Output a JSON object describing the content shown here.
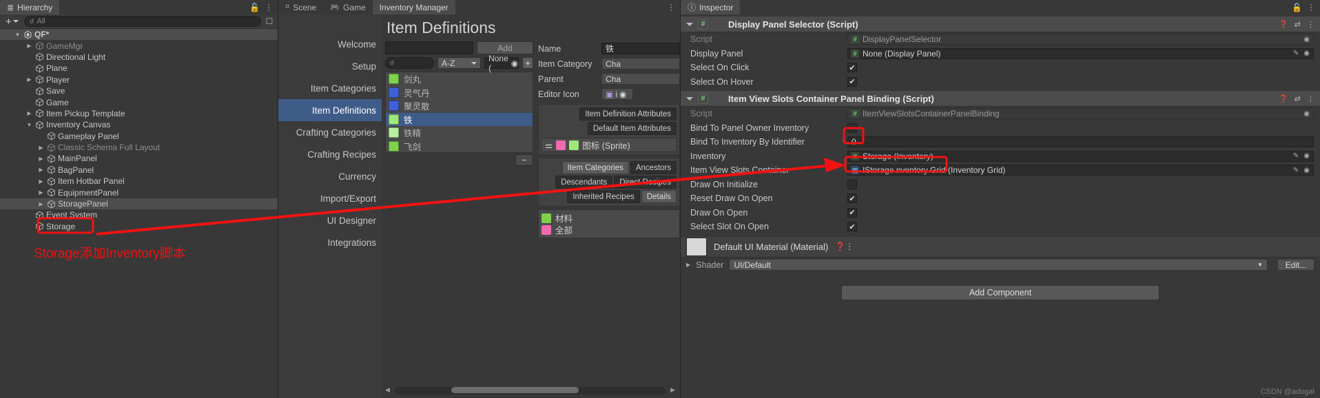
{
  "hierarchy": {
    "tab_label": "Hierarchy",
    "toolbar": {
      "add_label": "+",
      "search_placeholder": "All",
      "search_value": ""
    },
    "items": [
      {
        "label": "QF*",
        "depth": 0,
        "arrow": "open",
        "icon": "unity-logo-icon",
        "selected": true,
        "dim": false
      },
      {
        "label": "GameMgr",
        "depth": 1,
        "arrow": "closed",
        "icon": "cube-icon",
        "selected": false,
        "dim": true
      },
      {
        "label": "Directional Light",
        "depth": 1,
        "arrow": "none",
        "icon": "cube-icon",
        "selected": false,
        "dim": false
      },
      {
        "label": "Plane",
        "depth": 1,
        "arrow": "none",
        "icon": "cube-icon",
        "selected": false,
        "dim": false
      },
      {
        "label": "Player",
        "depth": 1,
        "arrow": "closed",
        "icon": "cube-icon",
        "selected": false,
        "dim": false
      },
      {
        "label": "Save",
        "depth": 1,
        "arrow": "none",
        "icon": "cube-icon",
        "selected": false,
        "dim": false
      },
      {
        "label": "Game",
        "depth": 1,
        "arrow": "none",
        "icon": "cube-icon",
        "selected": false,
        "dim": false
      },
      {
        "label": "Item Pickup Template",
        "depth": 1,
        "arrow": "closed",
        "icon": "cube-icon",
        "selected": false,
        "dim": false
      },
      {
        "label": "Inventory Canvas",
        "depth": 1,
        "arrow": "open",
        "icon": "cube-icon",
        "selected": false,
        "dim": false
      },
      {
        "label": "Gameplay Panel",
        "depth": 2,
        "arrow": "none",
        "icon": "cube-icon",
        "selected": false,
        "dim": false
      },
      {
        "label": "Classic Schema Full Layout",
        "depth": 2,
        "arrow": "closed",
        "icon": "cube-icon",
        "selected": false,
        "dim": true
      },
      {
        "label": "MainPanel",
        "depth": 2,
        "arrow": "closed",
        "icon": "cube-icon",
        "selected": false,
        "dim": false
      },
      {
        "label": "BagPanel",
        "depth": 2,
        "arrow": "closed",
        "icon": "cube-icon",
        "selected": false,
        "dim": false
      },
      {
        "label": "Item Hotbar Panel",
        "depth": 2,
        "arrow": "closed",
        "icon": "cube-icon",
        "selected": false,
        "dim": false
      },
      {
        "label": "EquipmentPanel",
        "depth": 2,
        "arrow": "closed",
        "icon": "cube-icon",
        "selected": false,
        "dim": false
      },
      {
        "label": "StoragePanel",
        "depth": 2,
        "arrow": "closed",
        "icon": "cube-icon",
        "selected": true,
        "dim": false
      },
      {
        "label": "Event System",
        "depth": 1,
        "arrow": "none",
        "icon": "cube-icon",
        "selected": false,
        "dim": false
      },
      {
        "label": "Storage",
        "depth": 1,
        "arrow": "none",
        "icon": "cube-icon",
        "selected": false,
        "dim": false
      }
    ],
    "annotation": "Storage添加Inventory脚本"
  },
  "center": {
    "tabs": [
      {
        "label": "Scene",
        "icon": "grid-icon",
        "active": false
      },
      {
        "label": "Game",
        "icon": "gamepad-icon",
        "active": false
      },
      {
        "label": "Inventory Manager",
        "icon": "none",
        "active": true
      }
    ],
    "nav": [
      {
        "label": "Welcome",
        "active": false
      },
      {
        "label": "Setup",
        "active": false
      },
      {
        "label": "Item Categories",
        "active": false
      },
      {
        "label": "Item Definitions",
        "active": true
      },
      {
        "label": "Crafting Categories",
        "active": false
      },
      {
        "label": "Crafting Recipes",
        "active": false
      },
      {
        "label": "Currency",
        "active": false
      },
      {
        "label": "Import/Export",
        "active": false
      },
      {
        "label": "UI Designer",
        "active": false
      },
      {
        "label": "Integrations",
        "active": false
      }
    ],
    "page_title": "Item Definitions",
    "add_button": "Add",
    "new_name_value": "",
    "search_placeholder": "",
    "sort_value": "A-Z",
    "filter_value": "None (",
    "plus_button": "+",
    "minus_button": "−",
    "item_list": [
      {
        "label": "剑丸",
        "color": "#7ed14a",
        "selected": false
      },
      {
        "label": "灵气丹",
        "color": "#3f62d8",
        "selected": false
      },
      {
        "label": "聚灵散",
        "color": "#3f62d8",
        "selected": false
      },
      {
        "label": "铁",
        "color": "#9fe87c",
        "selected": true
      },
      {
        "label": "铁精",
        "color": "#b7f0a0",
        "selected": false
      },
      {
        "label": "飞剑",
        "color": "#7ed14a",
        "selected": false
      }
    ],
    "detail": {
      "name_label": "Name",
      "name_value": "铁",
      "category_label": "Item Category",
      "category_value": "Cha",
      "parent_label": "Parent",
      "parent_value": "Cha",
      "editor_icon_label": "Editor Icon",
      "editor_icon_value": "i",
      "tabs_row1": [
        "Item Definition Attributes"
      ],
      "tabs_row2": [
        "Default Item Attributes"
      ],
      "sprite_value": "图标 (Sprite)",
      "cat_tabs": [
        "Item Categories",
        "Ancestors",
        "Descendants",
        "Direct Recipes",
        "Inherited Recipes",
        "Details"
      ],
      "tags": [
        {
          "label": "材料",
          "color": "#7ed14a"
        },
        {
          "label": "全部",
          "color": "#f06ab0"
        }
      ]
    }
  },
  "inspector": {
    "tab_label": "Inspector",
    "components": [
      {
        "title": "Display Panel Selector (Script)",
        "properties": [
          {
            "label": "Script",
            "type": "object",
            "value": "DisplayPanelSelector",
            "disabled": true,
            "highlight": false
          },
          {
            "label": "Display Panel",
            "type": "object",
            "value": "None (Display Panel)",
            "disabled": false,
            "highlight": false
          },
          {
            "label": "Select On Click",
            "type": "checkbox",
            "value": "✔",
            "disabled": false,
            "highlight": false
          },
          {
            "label": "Select On Hover",
            "type": "checkbox",
            "value": "✔",
            "disabled": false,
            "highlight": false
          }
        ]
      },
      {
        "title": "Item View Slots Container Panel Binding (Script)",
        "properties": [
          {
            "label": "Script",
            "type": "object",
            "value": "ItemViewSlotsContainerPanelBinding",
            "disabled": true,
            "highlight": false
          },
          {
            "label": "Bind To Panel Owner Inventory",
            "type": "checkbox",
            "value": "",
            "disabled": false,
            "highlight": true
          },
          {
            "label": "Bind To Inventory By Identifier",
            "type": "number",
            "value": "0",
            "disabled": false,
            "highlight": false
          },
          {
            "label": "Inventory",
            "type": "object",
            "value": "Storage (Inventory)",
            "disabled": false,
            "highlight": true
          },
          {
            "label": "Item View Slots Container",
            "type": "object",
            "value": "IStorage nventory Grid (Inventory Grid)",
            "disabled": false,
            "highlight": false
          },
          {
            "label": "Draw On Initialize",
            "type": "checkbox",
            "value": "",
            "disabled": false,
            "highlight": false
          },
          {
            "label": "Reset Draw On Open",
            "type": "checkbox",
            "value": "✔",
            "disabled": false,
            "highlight": false
          },
          {
            "label": "Draw On Open",
            "type": "checkbox",
            "value": "✔",
            "disabled": false,
            "highlight": false
          },
          {
            "label": "Select Slot On Open",
            "type": "checkbox",
            "value": "✔",
            "disabled": false,
            "highlight": false
          }
        ]
      }
    ],
    "material": {
      "name": "Default UI Material (Material)",
      "shader_label": "Shader",
      "shader_value": "UI/Default",
      "edit_label": "Edit..."
    },
    "add_component_label": "Add Component"
  },
  "watermark": "CSDN @adogal",
  "colors": {
    "accent_blue": "#3f5c89",
    "annotation_red": "#f31212",
    "panel_bg": "#383838"
  }
}
